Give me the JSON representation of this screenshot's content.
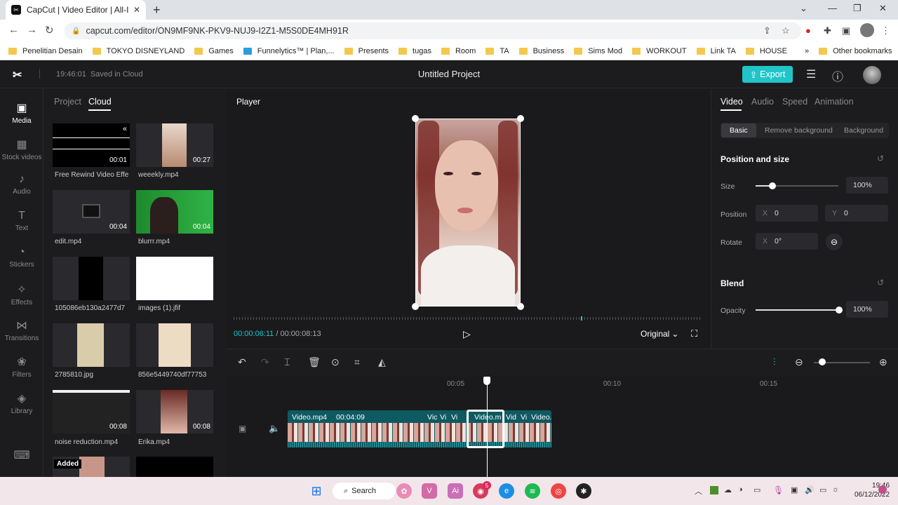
{
  "browser": {
    "tab_title": "CapCut | Video Editor | All-In-One",
    "url": "capcut.com/editor/ON9MF9NK-PKV9-NUJ9-I2Z1-M5S0DE4MH91R",
    "bookmarks": [
      "Penelitian Desain",
      "TOKYO DISNEYLAND",
      "Games",
      "Funnelytics™ | Plan,...",
      "Presents",
      "tugas",
      "Room",
      "TA",
      "Business",
      "Sims Mod",
      "WORKOUT",
      "Link TA",
      "HOUSE"
    ],
    "more_bookmarks": "»",
    "other_bookmarks": "Other bookmarks"
  },
  "header": {
    "saved_time": "19:46:01",
    "saved_label": "Saved in Cloud",
    "project_title": "Untitled Project",
    "export_label": "Export"
  },
  "leftnav": [
    {
      "label": "Media",
      "icon": "media-icon"
    },
    {
      "label": "Stock videos",
      "icon": "stock-videos-icon"
    },
    {
      "label": "Audio",
      "icon": "audio-icon"
    },
    {
      "label": "Text",
      "icon": "text-icon"
    },
    {
      "label": "Stickers",
      "icon": "stickers-icon"
    },
    {
      "label": "Effects",
      "icon": "effects-icon"
    },
    {
      "label": "Transitions",
      "icon": "transitions-icon"
    },
    {
      "label": "Filters",
      "icon": "filters-icon"
    },
    {
      "label": "Library",
      "icon": "library-icon"
    }
  ],
  "media": {
    "tabs": [
      "Project",
      "Cloud"
    ],
    "items": [
      {
        "name": "Free Rewind Video Effe",
        "duration": "00:01"
      },
      {
        "name": "weeekly.mp4",
        "duration": "00:27"
      },
      {
        "name": "edit.mp4",
        "duration": "00:04"
      },
      {
        "name": "blurrr.mp4",
        "duration": "00:04"
      },
      {
        "name": "105086eb130a2477d7",
        "duration": ""
      },
      {
        "name": "images (1).jfif",
        "duration": ""
      },
      {
        "name": "2785810.jpg",
        "duration": ""
      },
      {
        "name": "856e5449740df77753",
        "duration": ""
      },
      {
        "name": "noise reduction.mp4",
        "duration": "00:08"
      },
      {
        "name": "Erika.mp4",
        "duration": "00:08"
      }
    ],
    "added_badge": "Added"
  },
  "player": {
    "label": "Player",
    "current_time": "00:00:06:11",
    "separator": "/",
    "total_time": "00:00:08:13",
    "ratio": "Original"
  },
  "props": {
    "tabs": [
      "Video",
      "Audio",
      "Speed",
      "Animation"
    ],
    "subtabs": [
      "Basic",
      "Remove background",
      "Background"
    ],
    "position_size_title": "Position and size",
    "size_label": "Size",
    "size_value": "100%",
    "size_fraction": 0.2,
    "position_label": "Position",
    "pos_x_key": "X",
    "pos_x": "0",
    "pos_y_key": "Y",
    "pos_y": "0",
    "rotate_label": "Rotate",
    "rot_x_key": "X",
    "rot_value": "0°",
    "blend_title": "Blend",
    "opacity_label": "Opacity",
    "opacity_value": "100%"
  },
  "timeline": {
    "ticks": [
      "00:05",
      "00:10",
      "00:15"
    ],
    "clip_name": "Video.mp4",
    "clip_duration": "00:04:09",
    "small_clips": [
      "Vic",
      "Vi",
      "Vi"
    ],
    "selected_clip": "Video.m",
    "after_clips": [
      "Vid",
      "Vi",
      "Video.r"
    ]
  },
  "taskbar": {
    "search": "Search",
    "time": "19:46",
    "date": "06/12/2022",
    "badge": "5"
  },
  "colors": {
    "accent": "#20c5c8",
    "clip": "#0f5a61"
  }
}
